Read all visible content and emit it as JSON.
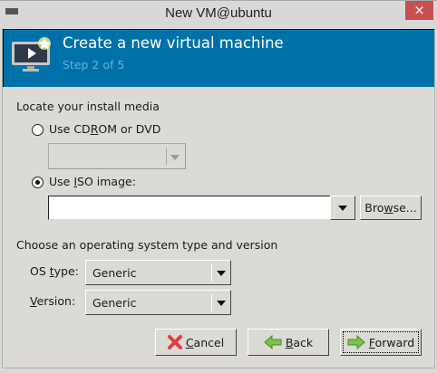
{
  "window": {
    "title": "New VM@ubuntu",
    "close": "×"
  },
  "banner": {
    "title": "Create a new virtual machine",
    "step": "Step 2 of 5"
  },
  "media": {
    "heading": "Locate your install media",
    "cdrom": {
      "pre": "Use CD",
      "mn": "R",
      "post": "OM or DVD",
      "selected": false
    },
    "iso": {
      "pre": "Use ",
      "mn": "I",
      "post": "SO image:",
      "selected": true,
      "value": ""
    },
    "browse": {
      "pre": "Bro",
      "mn": "w",
      "post": "se..."
    }
  },
  "os": {
    "heading": "Choose an operating system type and version",
    "type": {
      "pre": "OS ",
      "mn": "t",
      "post": "ype:",
      "value": "Generic"
    },
    "version": {
      "pre": "",
      "mn": "V",
      "post": "ersion:",
      "value": "Generic"
    }
  },
  "buttons": {
    "cancel": {
      "mn": "C",
      "post": "ancel"
    },
    "back": {
      "mn": "B",
      "post": "ack"
    },
    "forward": {
      "mn": "F",
      "post": "orward"
    }
  }
}
